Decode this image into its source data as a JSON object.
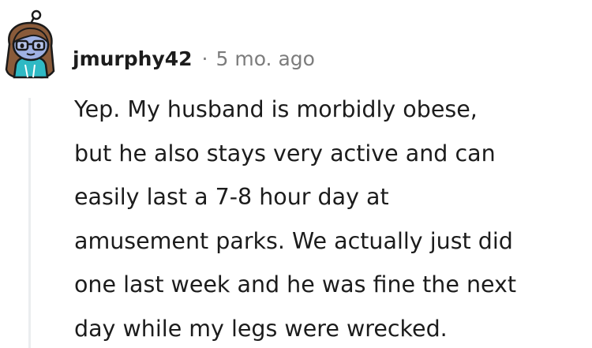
{
  "comment": {
    "author": {
      "username": "jmurphy42",
      "avatar_icon": "snoo-avatar-icon"
    },
    "separator": "·",
    "timestamp": "5 mo. ago",
    "body_lines": [
      "Yep. My husband is morbidly obese,",
      "but he also stays very active and can",
      "easily last a 7-8 hour day at",
      "amusement parks. We actually just did",
      "one last week and he was fine the next",
      "day while my legs were wrecked."
    ]
  },
  "colors": {
    "text": "#1c1c1c",
    "meta": "#7c7c7c",
    "thread_line": "#ebedef",
    "avatar_bg": "#7193ff",
    "avatar_skin": "#9fb1e3",
    "avatar_hair": "#8a5b3a"
  }
}
